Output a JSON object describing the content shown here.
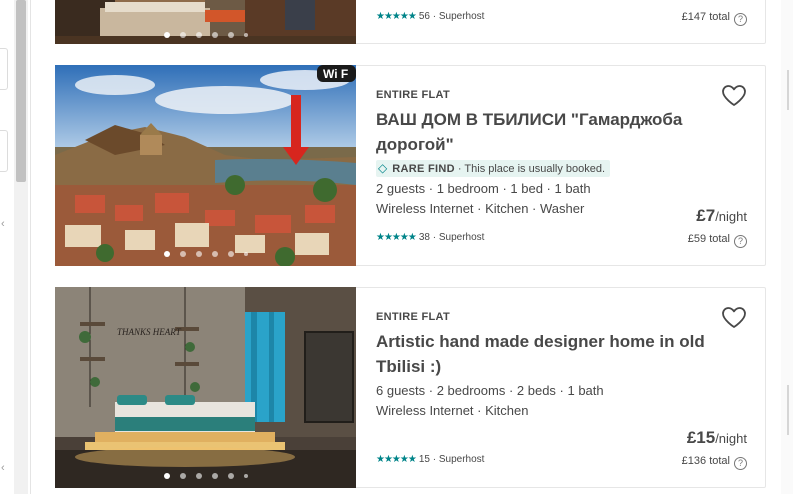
{
  "listings": [
    {
      "rating_stars": "★★★★★",
      "reviews": "56",
      "superhost": "· Superhost",
      "total": "£147 total",
      "info_glyph": "?"
    },
    {
      "kicker": "ENTIRE FLAT",
      "title": "ВАШ ДОМ В ТБИЛИСИ \"Гамарджоба дорогой\"",
      "rare_find_label": "RARE FIND",
      "rare_find_text": "· This place is usually booked.",
      "summary": "2 guests · 1 bedroom · 1 bed · 1 bath",
      "amenities": "Wireless Internet · Kitchen · Washer",
      "rating_stars": "★★★★★",
      "reviews": "38",
      "superhost": "· Superhost",
      "price": "£7",
      "price_unit": "/night",
      "total": "£59 total",
      "info_glyph": "?",
      "photo_badge": "Wi F"
    },
    {
      "kicker": "ENTIRE FLAT",
      "title": "Artistic hand made designer home in old Tbilisi :)",
      "summary": "6 guests · 2 bedrooms · 2 beds · 1 bath",
      "amenities": "Wireless Internet · Kitchen",
      "rating_stars": "★★★★★",
      "reviews": "15",
      "superhost": "· Superhost",
      "price": "£15",
      "price_unit": "/night",
      "total": "£136 total",
      "info_glyph": "?",
      "wall_text": "THANKS HEART"
    }
  ],
  "icons": {
    "heart": "heart-outline-icon",
    "rare_find": "diamond-icon",
    "info": "info-circle-icon"
  },
  "colors": {
    "accent": "#008489",
    "rare_find_bg": "#e6f4f1",
    "text": "#484848"
  },
  "ui": {
    "chevron": "‹"
  }
}
